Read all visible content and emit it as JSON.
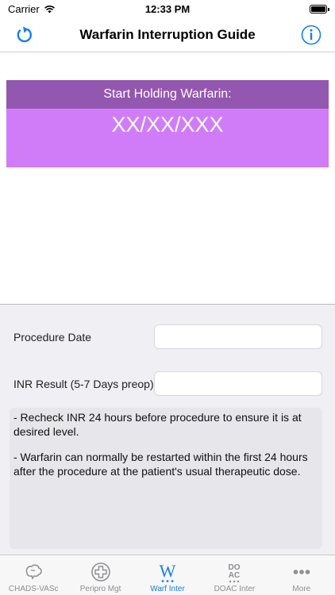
{
  "status_bar": {
    "carrier": "Carrier",
    "time": "12:33 PM"
  },
  "nav": {
    "title": "Warfarin Interruption Guide",
    "left_icon": "refresh-icon",
    "right_icon": "info-icon"
  },
  "holding": {
    "label": "Start Holding Warfarin:",
    "date": "XX/XX/XXX"
  },
  "form": {
    "procedure_date": {
      "label": "Procedure Date",
      "value": ""
    },
    "inr_result": {
      "label": "INR Result (5-7 Days preop)",
      "value": ""
    }
  },
  "notes": [
    "- Recheck INR 24 hours before procedure to ensure it is at desired level.",
    "- Warfarin can normally be restarted within the first 24 hours after the procedure at the patient's usual therapeutic dose."
  ],
  "tabs": [
    {
      "label": "CHADS-VASc",
      "icon": "brain-icon",
      "active": false
    },
    {
      "label": "Peripro Mgt",
      "icon": "medical-cross-icon",
      "active": false
    },
    {
      "label": "Warf Inter",
      "icon": "warfarin-w-icon",
      "active": true
    },
    {
      "label": "DOAC Inter",
      "icon": "doac-icon",
      "active": false
    },
    {
      "label": "More",
      "icon": "more-dots-icon",
      "active": false
    }
  ],
  "colors": {
    "accent": "#147efb",
    "holding_header": "#9457b0",
    "holding_body": "#d07cf9",
    "inactive_tab": "#8e8e93"
  }
}
